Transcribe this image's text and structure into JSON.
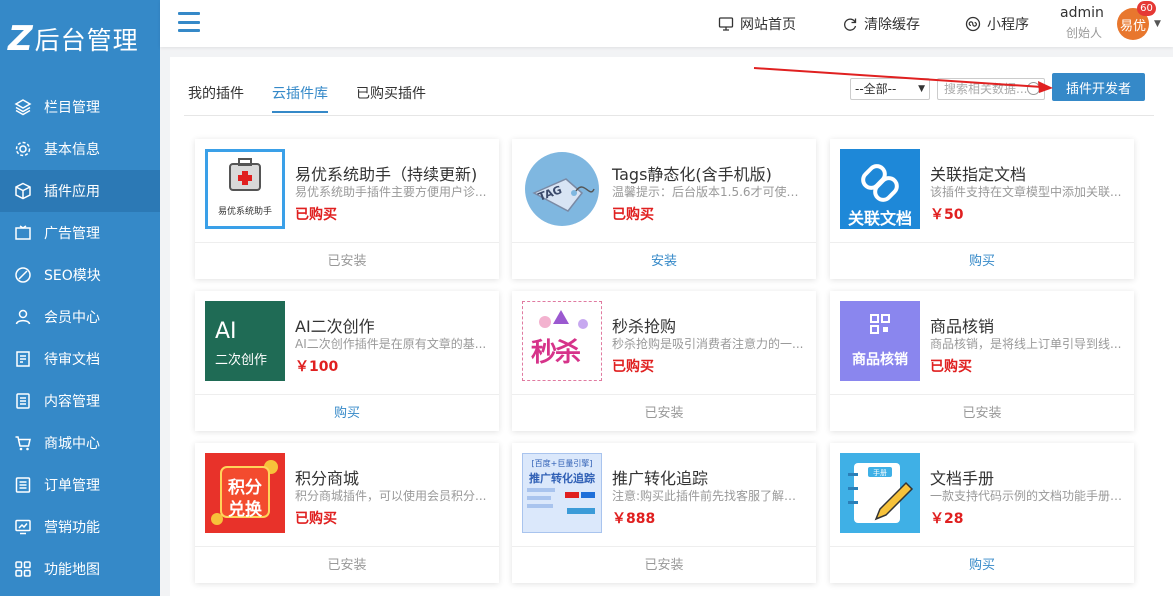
{
  "brand": {
    "mark": "Z",
    "title": "后台管理"
  },
  "sidebar": {
    "items": [
      {
        "label": "栏目管理",
        "icon": "layers-icon"
      },
      {
        "label": "基本信息",
        "icon": "gear-icon"
      },
      {
        "label": "插件应用",
        "icon": "cube-icon",
        "active": true
      },
      {
        "label": "广告管理",
        "icon": "ad-icon"
      },
      {
        "label": "SEO模块",
        "icon": "seo-icon"
      },
      {
        "label": "会员中心",
        "icon": "user-icon"
      },
      {
        "label": "待审文档",
        "icon": "pending-doc-icon"
      },
      {
        "label": "内容管理",
        "icon": "document-icon"
      },
      {
        "label": "商城中心",
        "icon": "cart-icon"
      },
      {
        "label": "订单管理",
        "icon": "order-list-icon"
      },
      {
        "label": "营销功能",
        "icon": "chart-monitor-icon"
      },
      {
        "label": "功能地图",
        "icon": "grid-map-icon"
      }
    ]
  },
  "topbar": {
    "home": "网站首页",
    "clear_cache": "清除缓存",
    "mini_program": "小程序",
    "user": {
      "name": "admin",
      "role": "创始人",
      "avatar_text": "易优",
      "badge": "60"
    }
  },
  "tabs": [
    "我的插件",
    "云插件库",
    "已购买插件"
  ],
  "filter": {
    "selected": "--全部--",
    "search_placeholder": "搜索相关数据..."
  },
  "dev_button": "插件开发者",
  "cards": [
    {
      "title": "易优系统助手（持续更新)",
      "desc": "易优系统助手插件主要方便用户诊...",
      "price": "已购买",
      "action": "已安装",
      "thumb": "易优系统助手"
    },
    {
      "title": "Tags静态化(含手机版)",
      "desc": "温馨提示：后台版本1.5.6才可使用...",
      "price": "已购买",
      "action": "安装",
      "thumb": "TAG"
    },
    {
      "title": "关联指定文档",
      "desc": "该插件支持在文章模型中添加关联...",
      "price": "￥50",
      "action": "购买",
      "thumb": "关联文档"
    },
    {
      "title": "AI二次创作",
      "desc": "AI二次创作插件是在原有文章的基...",
      "price": "￥100",
      "action": "购买",
      "thumb_line1": "AI",
      "thumb_line2": "二次创作"
    },
    {
      "title": "秒杀抢购",
      "desc": "秒杀抢购是吸引消费者注意力的一...",
      "price": "已购买",
      "action": "已安装",
      "thumb": "秒杀"
    },
    {
      "title": "商品核销",
      "desc": "商品核销，是将线上订单引导到线...",
      "price": "已购买",
      "action": "已安装",
      "thumb": "商品核销"
    },
    {
      "title": "积分商城",
      "desc": "积分商城插件，可以使用会员积分...",
      "price": "已购买",
      "action": "已安装",
      "thumb_line1": "积分",
      "thumb_line2": "兑换"
    },
    {
      "title": "推广转化追踪",
      "desc": "注意:购买此插件前先找客服了解理...",
      "price": "￥888",
      "action": "已安装",
      "thumb_line1": "[百度+巨量引擎]",
      "thumb_line2": "推广转化追踪"
    },
    {
      "title": "文档手册",
      "desc": "一款支持代码示例的文档功能手册 ...",
      "price": "￥28",
      "action": "购买",
      "thumb": "手册"
    }
  ]
}
